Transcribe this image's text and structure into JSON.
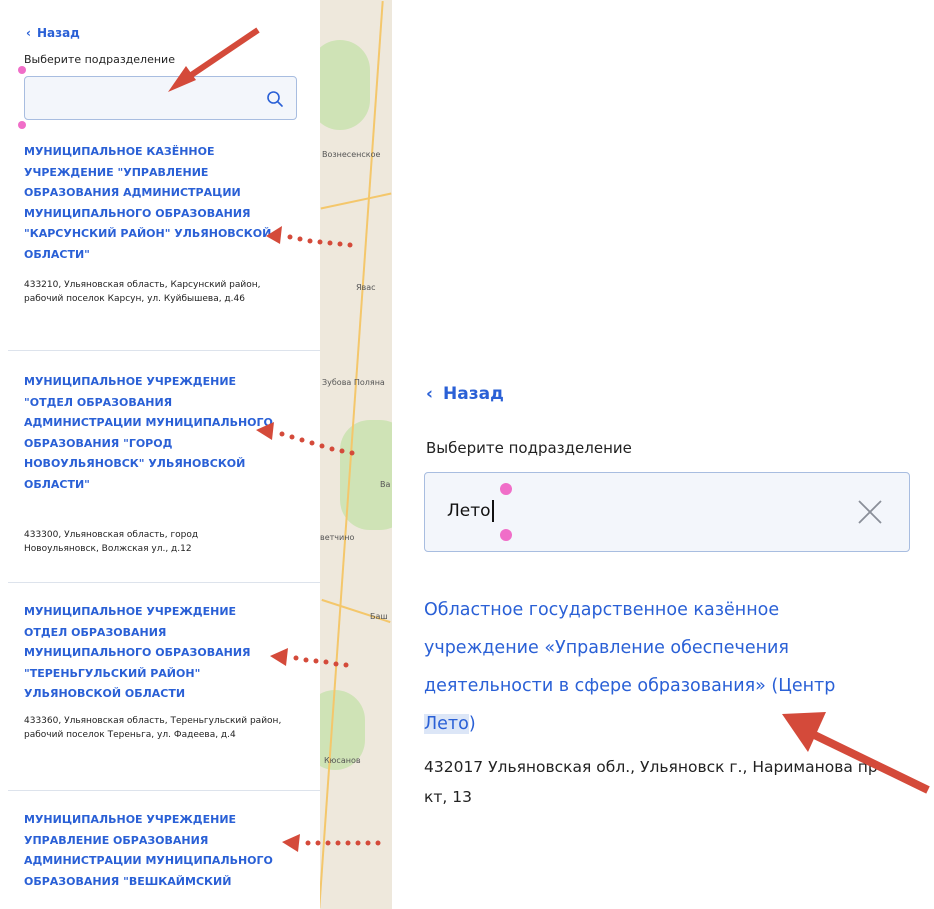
{
  "left": {
    "back_label": "Назад",
    "search_label": "Выберите подразделение",
    "search_value": "",
    "results": [
      {
        "name": "МУНИЦИПАЛЬНОЕ КАЗЁННОЕ УЧРЕЖДЕНИЕ \"УПРАВЛЕНИЕ ОБРАЗОВАНИЯ АДМИНИСТРАЦИИ МУНИЦИПАЛЬНОГО ОБРАЗОВАНИЯ \"КАРСУНСКИЙ РАЙОН\" УЛЬЯНОВСКОЙ ОБЛАСТИ\"",
        "address": "433210, Ульяновская область, Карсунский район, рабочий поселок Карсун, ул. Куйбышева, д.46"
      },
      {
        "name": "МУНИЦИПАЛЬНОЕ УЧРЕЖДЕНИЕ \"ОТДЕЛ ОБРАЗОВАНИЯ АДМИНИСТРАЦИИ МУНИЦИПАЛЬНОГО ОБРАЗОВАНИЯ \"ГОРОД НОВОУЛЬЯНОВСК\" УЛЬЯНОВСКОЙ ОБЛАСТИ\"",
        "address": "433300, Ульяновская область, город Новоульяновск, Волжская ул., д.12"
      },
      {
        "name": "МУНИЦИПАЛЬНОЕ УЧРЕЖДЕНИЕ ОТДЕЛ ОБРАЗОВАНИЯ МУНИЦИПАЛЬНОГО ОБРАЗОВАНИЯ \"ТЕРЕНЬГУЛЬСКИЙ РАЙОН\" УЛЬЯНОВСКОЙ ОБЛАСТИ",
        "address": "433360, Ульяновская область, Тереньгульский район, рабочий поселок Тереньга, ул. Фадеева, д.4"
      },
      {
        "name": "МУНИЦИПАЛЬНОЕ УЧРЕЖДЕНИЕ УПРАВЛЕНИЕ ОБРАЗОВАНИЯ АДМИНИСТРАЦИИ МУНИЦИПАЛЬНОГО ОБРАЗОВАНИЯ \"ВЕШКАЙМСКИЙ",
        "address": ""
      }
    ]
  },
  "map": {
    "places": [
      "Вознесенское",
      "Явас",
      "Зубова Поляна",
      "Ва",
      "ветчино",
      "Баш",
      "Кюсанов"
    ]
  },
  "right": {
    "back_label": "Назад",
    "search_label": "Выберите подразделение",
    "search_value": "Лето",
    "result": {
      "name_before": "Областное государственное казённое учреждение «Управление обеспечения деятельности в сфере образования» (Центр ",
      "name_highlight": "Лето",
      "name_after": ")",
      "address": "432017 Ульяновская обл., Ульяновск г., Нариманова пр-кт, 13"
    }
  },
  "colors": {
    "link": "#2a60d6",
    "annotation_arrow": "#d44a3a",
    "marker": "#f06ec8"
  },
  "icons": [
    "chevron-left-icon",
    "search-icon",
    "close-icon"
  ]
}
